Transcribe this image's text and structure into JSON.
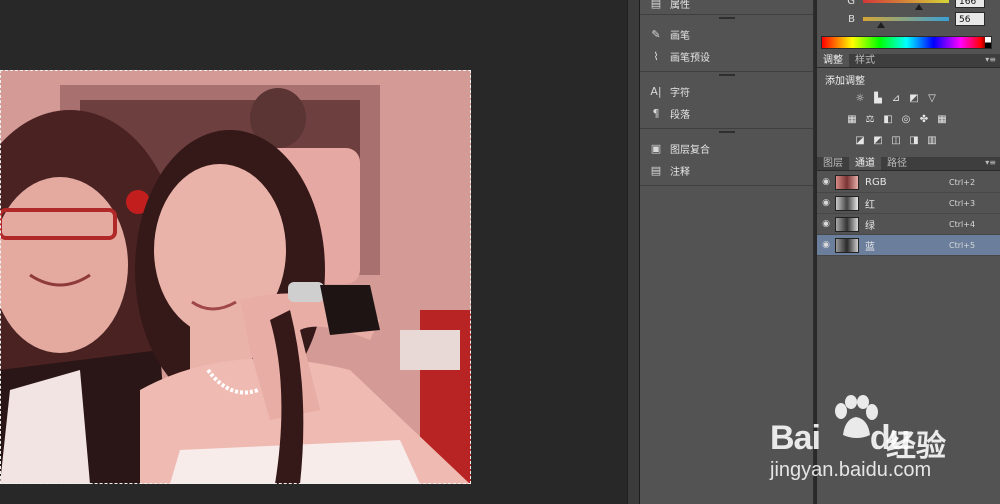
{
  "canvas": {
    "photo_description_colors": {
      "tint": "#c98a86"
    }
  },
  "mid_panel": {
    "items": [
      {
        "icon": "properties-icon",
        "label": "属性"
      },
      {
        "icon": "brush-icon",
        "label": "画笔"
      },
      {
        "icon": "brush-presets-icon",
        "label": "画笔预设"
      },
      {
        "icon": "character-icon",
        "label": "字符"
      },
      {
        "icon": "paragraph-icon",
        "label": "段落"
      },
      {
        "icon": "layer-comps-icon",
        "label": "图层复合"
      },
      {
        "icon": "notes-icon",
        "label": "注释"
      }
    ]
  },
  "color_panel": {
    "g_label": "G",
    "g_value": "166",
    "b_label": "B",
    "b_value": "56"
  },
  "adjust_panel": {
    "tabs": [
      "调整",
      "样式"
    ],
    "active_tab": "调整",
    "title": "添加调整"
  },
  "layers_panel": {
    "tabs": [
      "图层",
      "通道",
      "路径"
    ],
    "active_tab": "通道",
    "channels": [
      {
        "name": "RGB",
        "shortcut": "Ctrl+2",
        "selected": false
      },
      {
        "name": "红",
        "shortcut": "Ctrl+3",
        "selected": false
      },
      {
        "name": "绿",
        "shortcut": "Ctrl+4",
        "selected": false
      },
      {
        "name": "蓝",
        "shortcut": "Ctrl+5",
        "selected": true
      }
    ]
  },
  "watermark": {
    "logo": "Bai",
    "logo2": "du",
    "cn": "经验",
    "url": "jingyan.baidu.com"
  },
  "colors": {
    "selected_row": "#6b7f9d",
    "panel_bg": "#535353",
    "canvas_bg": "#282828"
  }
}
